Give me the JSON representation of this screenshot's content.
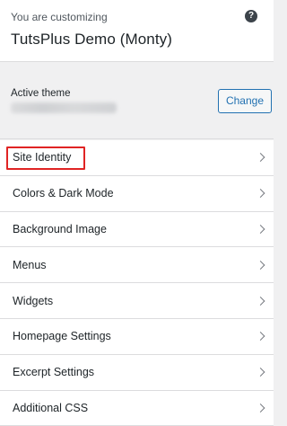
{
  "header": {
    "customizing_label": "You are customizing",
    "site_title": "TutsPlus Demo (Monty)",
    "help_icon": "help-icon",
    "help_symbol": "?"
  },
  "theme": {
    "active_label": "Active theme",
    "change_label": "Change"
  },
  "sections": [
    {
      "label": "Site Identity",
      "highlighted": true
    },
    {
      "label": "Colors & Dark Mode"
    },
    {
      "label": "Background Image"
    },
    {
      "label": "Menus"
    },
    {
      "label": "Widgets"
    },
    {
      "label": "Homepage Settings"
    },
    {
      "label": "Excerpt Settings"
    },
    {
      "label": "Additional CSS"
    }
  ],
  "colors": {
    "accent": "#2271b1",
    "highlight": "#e02424"
  }
}
